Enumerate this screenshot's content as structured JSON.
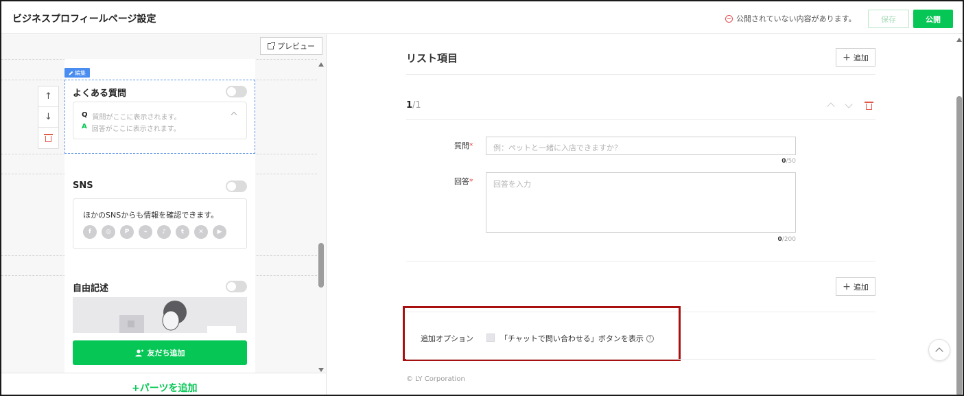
{
  "header": {
    "title": "ビジネスプロフィールページ設定",
    "unpublished_notice": "公開されていない内容があります。",
    "save_label": "保存",
    "publish_label": "公開"
  },
  "left": {
    "preview_label": "プレビュー",
    "edit_badge": "編集",
    "faq": {
      "title": "よくある質問",
      "q_mark": "Q",
      "q_text": "質問がここに表示されます。",
      "a_mark": "A",
      "a_text": "回答がここに表示されます。"
    },
    "sns": {
      "title": "SNS",
      "text": "ほかのSNSからも情報を確認できます。",
      "icons": [
        "facebook-icon",
        "instagram-icon",
        "pinterest-icon",
        "messenger-icon",
        "tiktok-icon",
        "tumblr-icon",
        "x-icon",
        "youtube-icon"
      ]
    },
    "free": {
      "title": "自由記述"
    },
    "add_friend_label": "友だち追加",
    "add_parts_label": "+パーツを追加"
  },
  "right": {
    "list_title": "リスト項目",
    "add_label": "追加",
    "counter_current": "1",
    "counter_total": "/1",
    "question_label": "質問",
    "question_placeholder": "例：ペットと一緒に入店できますか？",
    "question_count": "0",
    "question_max": "/50",
    "answer_label": "回答",
    "answer_placeholder": "回答を入力",
    "answer_count": "0",
    "answer_max": "/200",
    "required_mark": "*",
    "option_label": "追加オプション",
    "chat_button_option": "「チャットで問い合わせる」ボタンを表示",
    "help_mark": "?",
    "copyright": "© LY Corporation"
  },
  "colors": {
    "brand_green": "#06c755",
    "highlight_red": "#a81010",
    "selection_blue": "#5b93e6"
  }
}
